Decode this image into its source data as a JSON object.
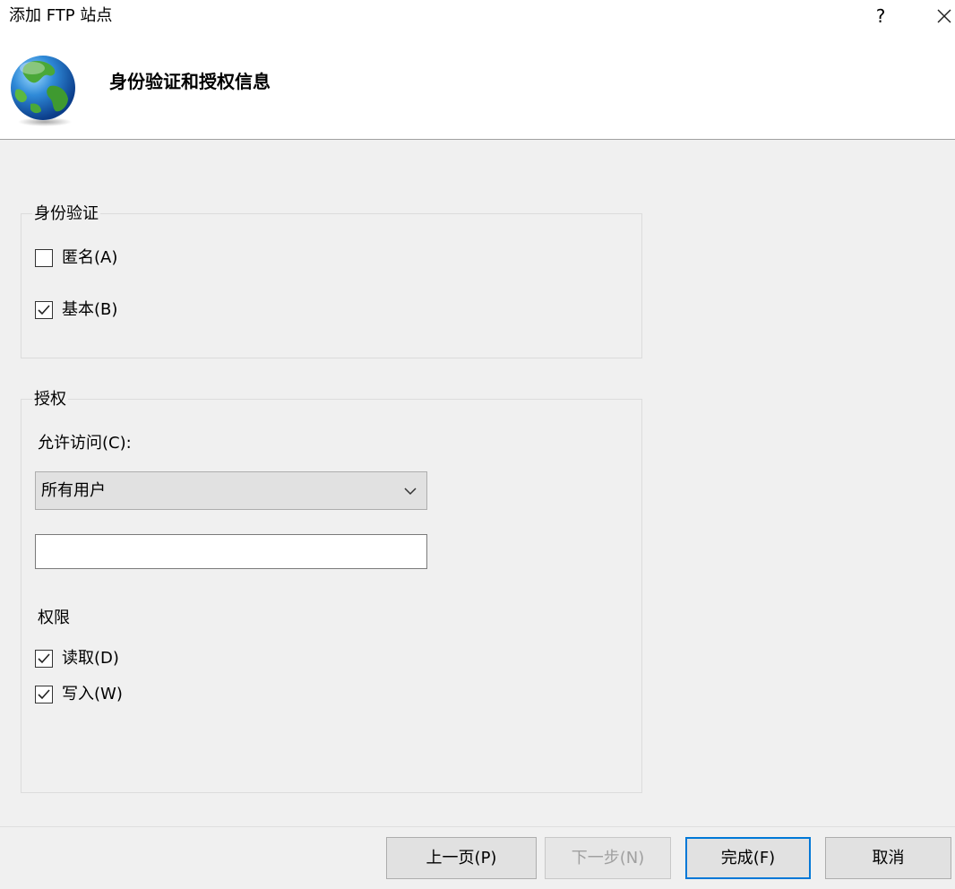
{
  "window": {
    "title": "添加 FTP 站点",
    "help_label": "?",
    "close_icon": "close-icon"
  },
  "header": {
    "title": "身份验证和授权信息",
    "icon": "globe-icon"
  },
  "authentication": {
    "legend": "身份验证",
    "anonymous": {
      "label": "匿名(A)",
      "checked": false
    },
    "basic": {
      "label": "基本(B)",
      "checked": true
    }
  },
  "authorization": {
    "legend": "授权",
    "allow_access_label": "允许访问(C):",
    "allow_access_selected": "所有用户",
    "user_input_value": "",
    "permissions_label": "权限",
    "read": {
      "label": "读取(D)",
      "checked": true
    },
    "write": {
      "label": "写入(W)",
      "checked": true
    }
  },
  "footer": {
    "prev_label": "上一页(P)",
    "next_label": "下一步(N)",
    "finish_label": "完成(F)",
    "cancel_label": "取消"
  },
  "colors": {
    "accent": "#0078d7",
    "background": "#f0f0f0"
  }
}
